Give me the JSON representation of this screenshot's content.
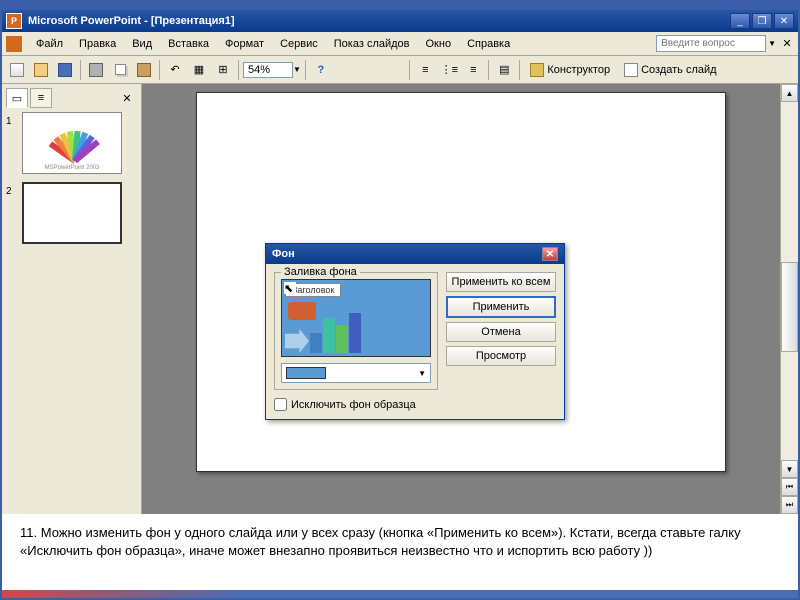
{
  "window": {
    "title": "Microsoft PowerPoint - [Презентация1]",
    "minimize": "_",
    "restore": "❐",
    "close": "✕"
  },
  "menubar": {
    "items": [
      "Файл",
      "Правка",
      "Вид",
      "Вставка",
      "Формат",
      "Сервис",
      "Показ слайдов",
      "Окно",
      "Справка"
    ],
    "help_placeholder": "Введите вопрос",
    "doc_close": "✕"
  },
  "toolbar": {
    "zoom": "54%",
    "designer": "Конструктор",
    "new_slide": "Создать слайд"
  },
  "thumbs": {
    "tab_close": "✕",
    "items": [
      {
        "num": "1",
        "type": "fan",
        "caption": "MSPowerPoint 2003"
      },
      {
        "num": "2",
        "type": "blank"
      }
    ]
  },
  "dialog": {
    "title": "Фон",
    "close": "✕",
    "group_label": "Заливка фона",
    "preview_header": "Заголовок",
    "buttons": {
      "apply_all": "Применить ко всем",
      "apply": "Применить",
      "cancel": "Отмена",
      "preview": "Просмотр"
    },
    "exclude_master": "Исключить фон образца"
  },
  "notes": {
    "text": "11.   Можно изменить фон у одного слайда или у всех сразу (кнопка «Применить ко всем»). Кстати, всегда ставьте галку «Исключить фон образца», иначе может внезапно проявиться неизвестно что и испортить всю работу ))"
  }
}
